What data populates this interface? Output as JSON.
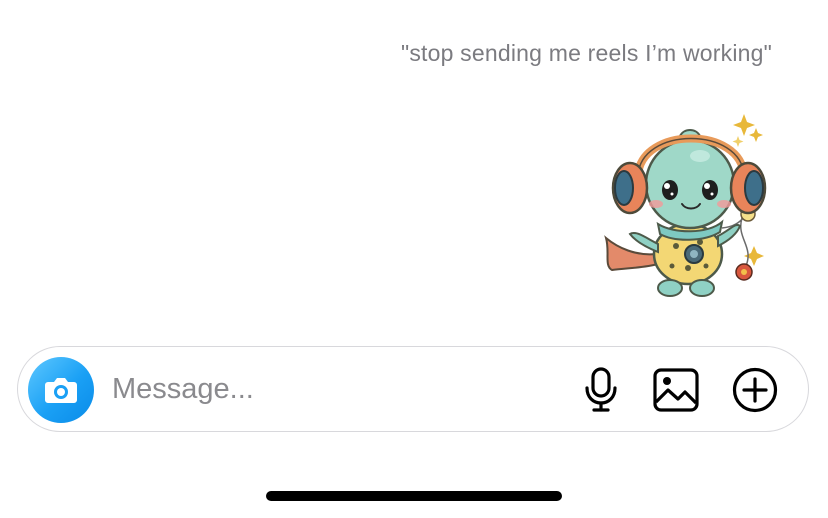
{
  "thread": {
    "quote_text": "\"stop sending me reels I’m working\"",
    "sticker_name": "turtle-with-headphones-sticker"
  },
  "composer": {
    "placeholder": "Message...",
    "value": "",
    "camera_icon": "camera-icon",
    "mic_icon": "microphone-icon",
    "gallery_icon": "gallery-icon",
    "plus_icon": "plus-circle-icon",
    "accent_color": "#1aa0f5"
  }
}
